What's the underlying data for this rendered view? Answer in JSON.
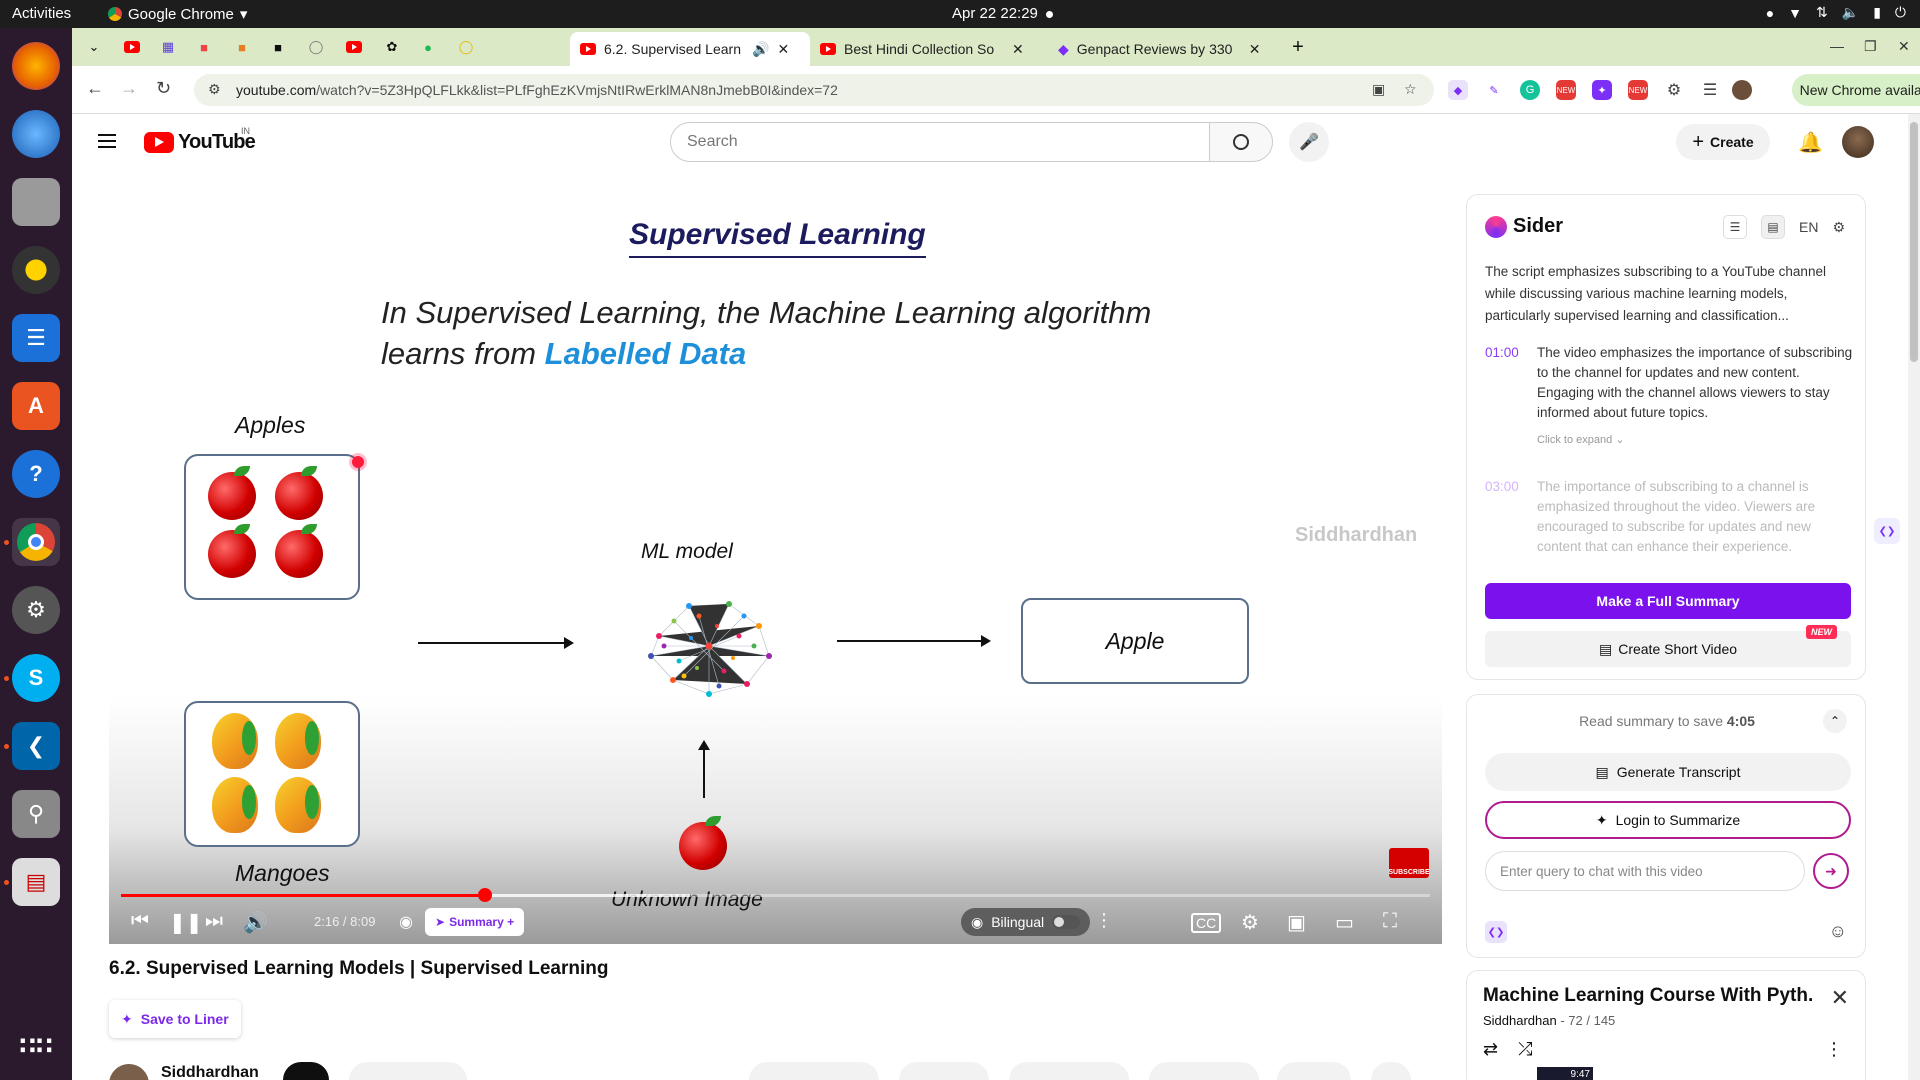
{
  "os": {
    "activities": "Activities",
    "app_name": "Google Chrome",
    "clock": "Apr 22  22:29"
  },
  "tabs": {
    "active_title": "6.2. Supervised Learn",
    "tab2_title": "Best Hindi Collection So",
    "tab3_title": "Genpact Reviews by 330"
  },
  "address": {
    "url_domain": "youtube.com",
    "url_path": "/watch?v=5Z3HpQLFLkk&list=PLfFghEzKVmjsNtIRwErklMAN8nJmebB0I&index=72",
    "new_chrome": "New Chrome available",
    "new_badge": "NEW"
  },
  "youtube": {
    "logo_text": "YouTube",
    "country": "IN",
    "search_placeholder": "Search",
    "create_label": "Create"
  },
  "slide": {
    "title": "Supervised Learning",
    "subtitle_line1": "In Supervised Learning, the Machine Learning algorithm",
    "subtitle_line2_prefix": "learns from ",
    "subtitle_highlight": "Labelled Data",
    "apples_label": "Apples",
    "mangoes_label": "Mangoes",
    "model_label": "ML model",
    "result_label": "Apple",
    "unknown_label": "Unknown Image",
    "watermark": "Siddhardhan",
    "subscribe_label": "SUBSCRIBE"
  },
  "player": {
    "time": "2:16 / 8:09",
    "progress_fraction": 0.278,
    "buffer_fraction": 0.435,
    "summary_chip": "Summary +",
    "bilingual": "Bilingual"
  },
  "video": {
    "title": "6.2. Supervised Learning Models | Supervised Learning",
    "save_to_liner": "Save to Liner",
    "channel": "Siddhardhan"
  },
  "sider": {
    "name": "Sider",
    "lang": "EN",
    "summary": "The script emphasizes subscribing to a YouTube channel while discussing various machine learning models, particularly supervised learning and classification...",
    "items": [
      {
        "time": "01:00",
        "text": "The video emphasizes the importance of subscribing to the channel for updates and new content. Engaging with the channel allows viewers to stay informed about future topics."
      },
      {
        "time": "03:00",
        "text": "The importance of subscribing to a channel is emphasized throughout the video. Viewers are encouraged to subscribe for updates and new content that can enhance their experience."
      }
    ],
    "expand_hint": "Click to expand ⌄",
    "full_summary_btn": "Make a Full Summary",
    "short_video_btn": "Create Short Video",
    "new_badge": "NEW",
    "read_save_prefix": "Read summary to save",
    "read_save_time": "4:05",
    "generate_transcript": "Generate Transcript",
    "login_summarize": "Login to Summarize",
    "chat_placeholder": "Enter query to chat with this video"
  },
  "playlist": {
    "title": "Machine Learning Course With Pyth...",
    "channel": "Siddhardhan",
    "position": " - 72 / 145",
    "thumb_time": "9:47"
  }
}
